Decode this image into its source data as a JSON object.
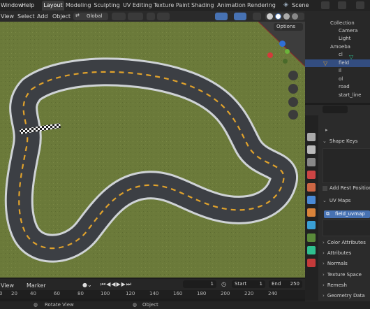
{
  "menu": {
    "items": [
      "Window",
      "Help"
    ]
  },
  "workspace_tabs": [
    "Layout",
    "Modeling",
    "Sculpting",
    "UV Editing",
    "Texture Paint",
    "Shading",
    "Animation",
    "Rendering"
  ],
  "scene": {
    "label": "Scene"
  },
  "viewport_header": {
    "view": "View",
    "select": "Select",
    "add": "Add",
    "object": "Object",
    "transform": "Global"
  },
  "options_label": "Options",
  "outliner": {
    "rows": [
      {
        "label": "Collection",
        "indent": 1
      },
      {
        "label": "Camera",
        "indent": 2
      },
      {
        "label": "Light",
        "indent": 2
      },
      {
        "label": "Amoeba",
        "indent": 1
      },
      {
        "label": "cl",
        "indent": 2
      },
      {
        "label": "field",
        "indent": 2,
        "selected": true
      },
      {
        "label": "il",
        "indent": 2
      },
      {
        "label": "ol",
        "indent": 2
      },
      {
        "label": "road",
        "indent": 2
      },
      {
        "label": "start_line",
        "indent": 2
      }
    ]
  },
  "properties": {
    "shape_keys": "Shape Keys",
    "add_rest_position": "Add Rest Position",
    "uv_maps": "UV Maps",
    "uv_map_item": "field_uvmap",
    "sections": [
      "Color Attributes",
      "Attributes",
      "Normals",
      "Texture Space",
      "Remesh",
      "Geometry Data"
    ]
  },
  "timeline": {
    "view": "View",
    "marker": "Marker",
    "current_frame": "1",
    "start_label": "Start",
    "start_value": "1",
    "end_label": "End",
    "end_value": "250",
    "ticks": [
      "0",
      "20",
      "40",
      "60",
      "80",
      "100",
      "120",
      "140",
      "160",
      "180",
      "200",
      "220",
      "240"
    ]
  },
  "status": {
    "left": "Rotate View",
    "right": "Object"
  },
  "colors": {
    "accent": "#4772b3",
    "grass": "#6a7a3a",
    "road": "#3a3d42",
    "dash": "#e0a22c"
  }
}
